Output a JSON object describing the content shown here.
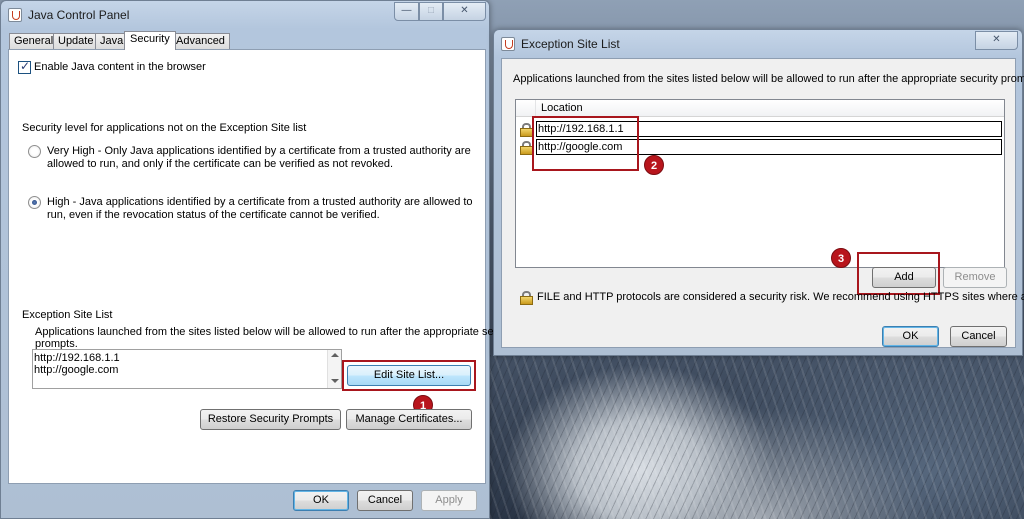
{
  "control_panel": {
    "title": "Java Control Panel",
    "caption_buttons": {
      "minimize": "—",
      "maximize": "□",
      "close": "✕"
    },
    "tabs": [
      "General",
      "Update",
      "Java",
      "Security",
      "Advanced"
    ],
    "active_tab": "Security",
    "enable_java_label": "Enable Java content in the browser",
    "enable_java_checked": true,
    "security_level_heading": "Security level for applications not on the Exception Site list",
    "very_high_line1": "Very High - Only Java applications identified by a certificate from a trusted authority are",
    "very_high_line2": "allowed to run, and only if the certificate can be verified as not revoked.",
    "high_line1": "High - Java applications identified by a certificate from a trusted authority are allowed to",
    "high_line2": "run, even if the revocation status of the certificate cannot be verified.",
    "selected_level": "High",
    "exception_heading": "Exception Site List",
    "exception_desc_line1": "Applications launched from the sites listed below will be allowed to run after the appropriate security",
    "exception_desc_line2": "prompts.",
    "sites": [
      "http://192.168.1.1",
      "http://google.com"
    ],
    "edit_site_list_label": "Edit Site List...",
    "restore_prompts_label": "Restore Security Prompts",
    "manage_certs_label": "Manage Certificates...",
    "ok_label": "OK",
    "cancel_label": "Cancel",
    "apply_label": "Apply"
  },
  "exception_dialog": {
    "title": "Exception Site List",
    "close": "✕",
    "description": "Applications launched from the sites listed below will be allowed to run after the appropriate security prompts.",
    "column_header": "Location",
    "rows": [
      "http://192.168.1.1",
      "http://google.com"
    ],
    "add_label": "Add",
    "remove_label": "Remove",
    "warning": "FILE and HTTP protocols are considered a security risk.  We recommend using HTTPS sites where available.",
    "ok_label": "OK",
    "cancel_label": "Cancel"
  },
  "annotations": {
    "step1": "1",
    "step2": "2",
    "step3": "3"
  },
  "colors": {
    "highlight_red": "#a8161d",
    "badge_red": "#b8151c",
    "focus_blue": "#3c7fb1"
  }
}
